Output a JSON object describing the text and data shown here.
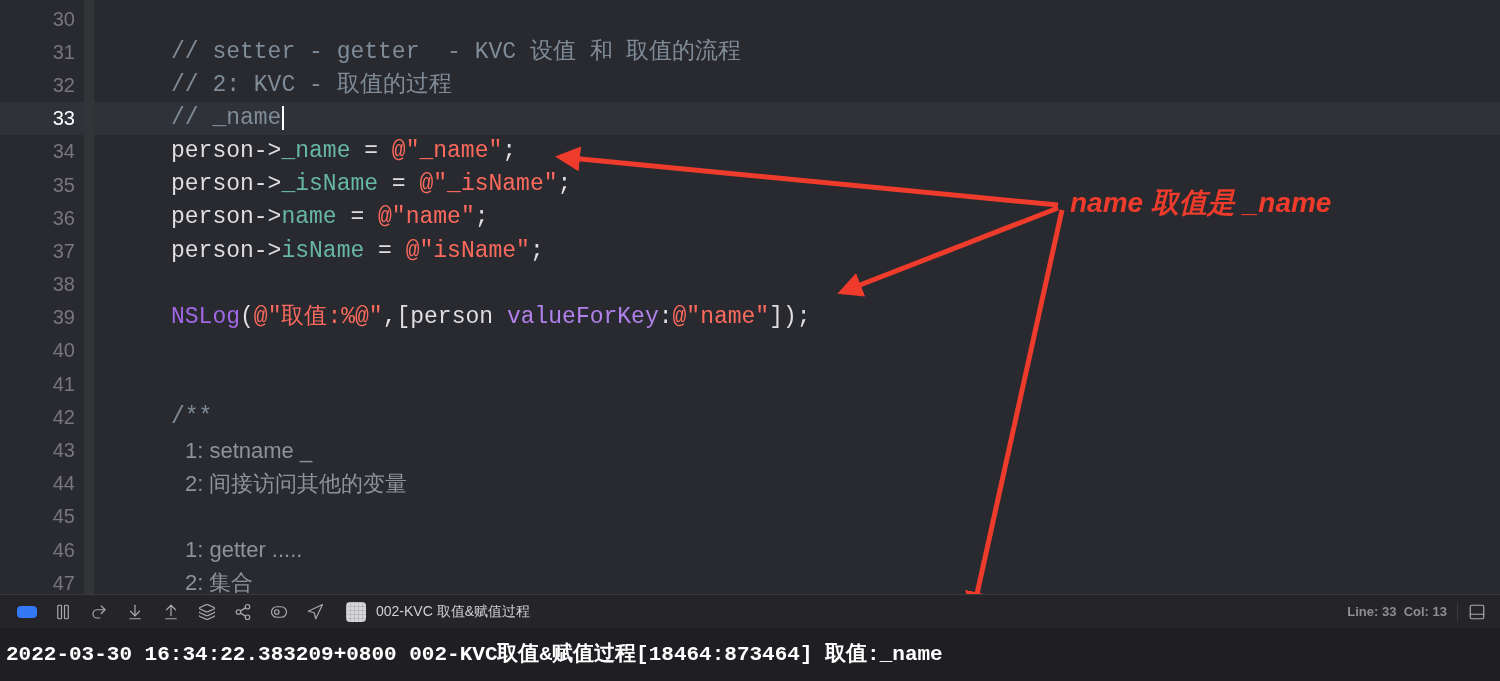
{
  "editor": {
    "lines": [
      {
        "number": "30",
        "current": false
      },
      {
        "number": "31",
        "current": false,
        "tokens": [
          {
            "kind": "comment",
            "text": "// setter - getter  - KVC 设值 和 取值的流程"
          }
        ]
      },
      {
        "number": "32",
        "current": false,
        "tokens": [
          {
            "kind": "comment",
            "text": "// 2: KVC - 取值的过程"
          }
        ]
      },
      {
        "number": "33",
        "current": true,
        "tokens": [
          {
            "kind": "comment",
            "text": "// _name"
          }
        ]
      },
      {
        "number": "34",
        "current": false,
        "tokens": [
          {
            "kind": "plain",
            "text": "person->"
          },
          {
            "kind": "var",
            "text": "_name"
          },
          {
            "kind": "plain",
            "text": " = "
          },
          {
            "kind": "string",
            "text": "@\"_name\""
          },
          {
            "kind": "plain",
            "text": ";"
          }
        ]
      },
      {
        "number": "35",
        "current": false,
        "tokens": [
          {
            "kind": "plain",
            "text": "person->"
          },
          {
            "kind": "var",
            "text": "_isName"
          },
          {
            "kind": "plain",
            "text": " = "
          },
          {
            "kind": "string",
            "text": "@\"_isName\""
          },
          {
            "kind": "plain",
            "text": ";"
          }
        ]
      },
      {
        "number": "36",
        "current": false,
        "tokens": [
          {
            "kind": "plain",
            "text": "person->"
          },
          {
            "kind": "var",
            "text": "name"
          },
          {
            "kind": "plain",
            "text": " = "
          },
          {
            "kind": "string",
            "text": "@\"name\""
          },
          {
            "kind": "plain",
            "text": ";"
          }
        ]
      },
      {
        "number": "37",
        "current": false,
        "tokens": [
          {
            "kind": "plain",
            "text": "person->"
          },
          {
            "kind": "var",
            "text": "isName"
          },
          {
            "kind": "plain",
            "text": " = "
          },
          {
            "kind": "string",
            "text": "@\"isName\""
          },
          {
            "kind": "plain",
            "text": ";"
          }
        ]
      },
      {
        "number": "38",
        "current": false
      },
      {
        "number": "39",
        "current": false,
        "tokens": [
          {
            "kind": "macro",
            "text": "NSLog"
          },
          {
            "kind": "plain",
            "text": "("
          },
          {
            "kind": "string",
            "text": "@\"取值:%@\""
          },
          {
            "kind": "plain",
            "text": ",[person "
          },
          {
            "kind": "method",
            "text": "valueForKey"
          },
          {
            "kind": "plain",
            "text": ":"
          },
          {
            "kind": "string",
            "text": "@\"name\""
          },
          {
            "kind": "plain",
            "text": "]);"
          }
        ]
      },
      {
        "number": "40",
        "current": false
      },
      {
        "number": "41",
        "current": false
      },
      {
        "number": "42",
        "current": false,
        "tokens": [
          {
            "kind": "comment",
            "text": "/**"
          }
        ]
      },
      {
        "number": "43",
        "current": false,
        "tokens": [
          {
            "kind": "doc",
            "text": "1: setname _"
          }
        ]
      },
      {
        "number": "44",
        "current": false,
        "tokens": [
          {
            "kind": "doc",
            "text": "2: 间接访问其他的变量"
          }
        ]
      },
      {
        "number": "45",
        "current": false
      },
      {
        "number": "46",
        "current": false,
        "tokens": [
          {
            "kind": "doc",
            "text": "1: getter ....."
          }
        ]
      },
      {
        "number": "47",
        "current": false,
        "tokens": [
          {
            "kind": "doc",
            "text": "2: 集合"
          }
        ]
      }
    ]
  },
  "annotation": {
    "text": "name 取值是 _name"
  },
  "debug_bar": {
    "buttons": [
      {
        "kind": "breakpoints"
      },
      {
        "kind": "pause"
      },
      {
        "kind": "step-over"
      },
      {
        "kind": "step-into"
      },
      {
        "kind": "step-out"
      },
      {
        "kind": "view-hierarchy"
      },
      {
        "kind": "memory-graph"
      },
      {
        "kind": "environment"
      },
      {
        "kind": "location"
      }
    ],
    "target": "002-KVC 取值&赋值过程",
    "position": "Line: 33  Col: 13"
  },
  "console": {
    "output": "2022-03-30 16:34:22.383209+0800 002-KVC取值&赋值过程[18464:873464] 取值:_name"
  }
}
